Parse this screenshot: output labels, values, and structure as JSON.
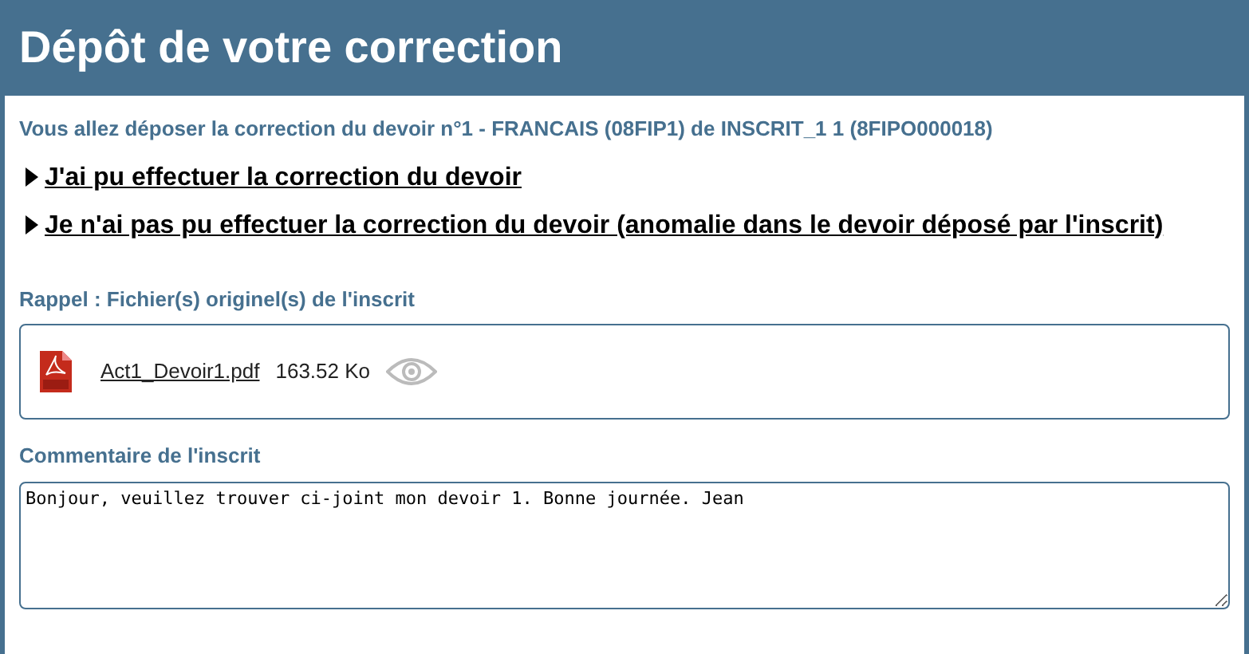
{
  "title": "Dépôt de votre correction",
  "intro": "Vous allez déposer la correction du devoir n°1 - FRANCAIS (08FIP1) de INSCRIT_1 1 (8FIPO000018)",
  "choices": [
    {
      "label": "J'ai pu effectuer la correction du devoir"
    },
    {
      "label": "Je n'ai pas pu effectuer la correction du devoir (anomalie dans le devoir déposé par l'inscrit)"
    }
  ],
  "files_section": {
    "title": "Rappel : Fichier(s) originel(s) de l'inscrit",
    "files": [
      {
        "name": "Act1_Devoir1.pdf",
        "size": "163.52 Ko"
      }
    ]
  },
  "comment_section": {
    "title": "Commentaire de l'inscrit",
    "value": "Bonjour, veuillez trouver ci-joint mon devoir 1. Bonne journée. Jean"
  }
}
